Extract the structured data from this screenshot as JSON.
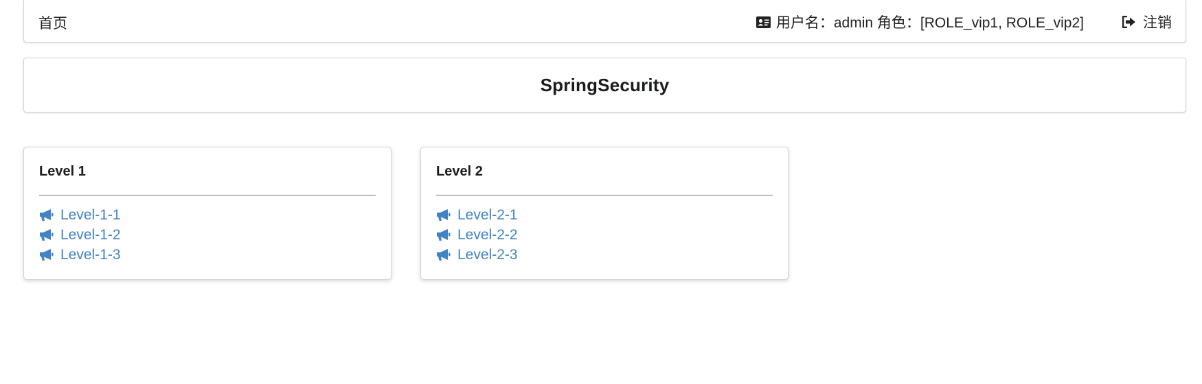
{
  "nav": {
    "home_label": "首页",
    "user_label": "用户名：admin 角色：[ROLE_vip1, ROLE_vip2]",
    "user_icon": "id-card-icon",
    "logout_label": "注销",
    "logout_icon": "sign-out-icon"
  },
  "header": {
    "title": "SpringSecurity"
  },
  "cards": [
    {
      "title": "Level 1",
      "links": [
        {
          "label": "Level-1-1",
          "icon": "bullhorn-icon"
        },
        {
          "label": "Level-1-2",
          "icon": "bullhorn-icon"
        },
        {
          "label": "Level-1-3",
          "icon": "bullhorn-icon"
        }
      ]
    },
    {
      "title": "Level 2",
      "links": [
        {
          "label": "Level-2-1",
          "icon": "bullhorn-icon"
        },
        {
          "label": "Level-2-2",
          "icon": "bullhorn-icon"
        },
        {
          "label": "Level-2-3",
          "icon": "bullhorn-icon"
        }
      ]
    }
  ],
  "colors": {
    "link": "#4183c4",
    "text": "#222222",
    "border": "#d4d4d5"
  }
}
